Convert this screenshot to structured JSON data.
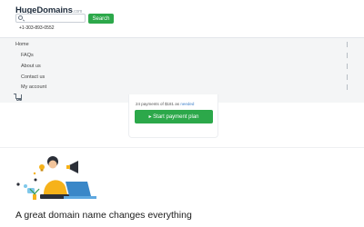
{
  "header": {
    "logo_main": "HugeDomains",
    "logo_tld": ".com",
    "search": {
      "placeholder": "",
      "value": ""
    },
    "search_button": "Search",
    "phone": "+1-303-893-0552"
  },
  "menu": {
    "items": [
      {
        "label": "Home"
      },
      {
        "label": "FAQs"
      },
      {
        "label": "About us"
      },
      {
        "label": "Contact us"
      },
      {
        "label": "My account"
      }
    ],
    "cart_icon": "cart-icon"
  },
  "payment": {
    "text": "24 payments of $181 as",
    "link": "needed",
    "button": "▸ Start payment plan"
  },
  "tagline": "A great domain name changes everything",
  "colors": {
    "accent_green": "#2ca84a",
    "link_blue": "#3d7fc9",
    "menu_bg": "#f4f5f6"
  }
}
